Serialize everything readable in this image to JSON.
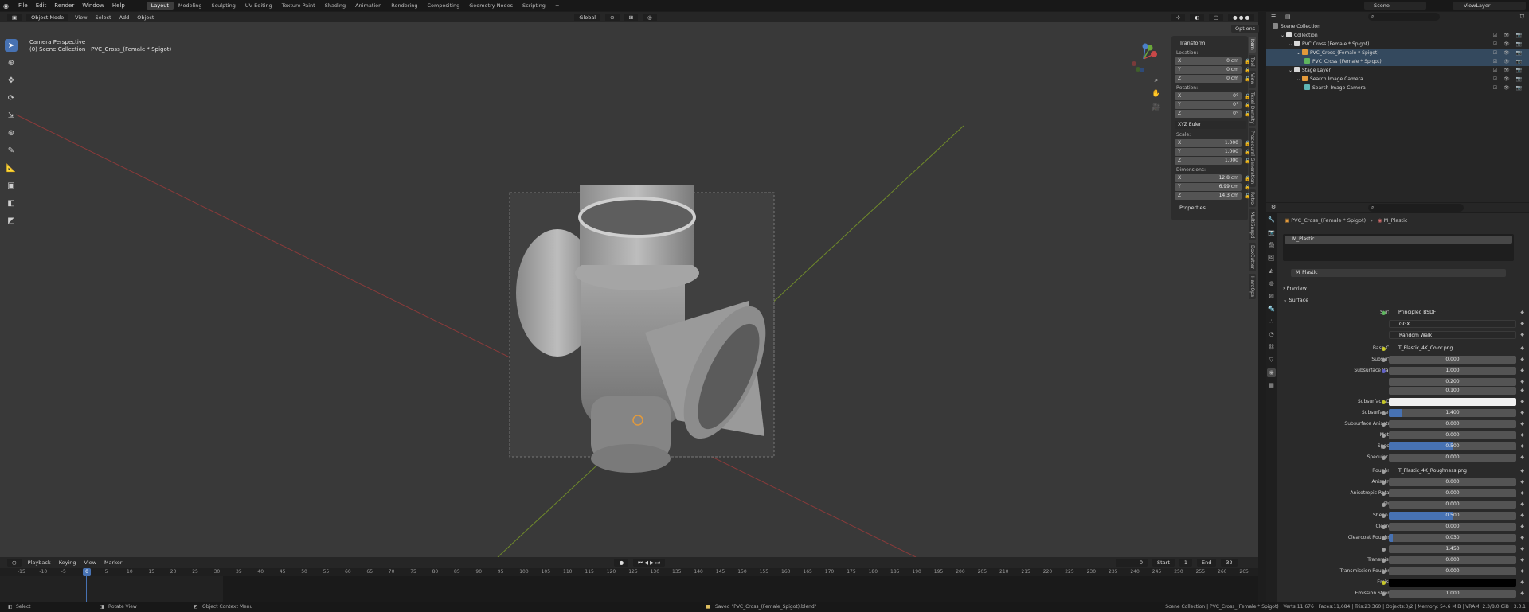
{
  "menu": [
    "File",
    "Edit",
    "Render",
    "Window",
    "Help"
  ],
  "workspaces": [
    "Layout",
    "Modeling",
    "Sculpting",
    "UV Editing",
    "Texture Paint",
    "Shading",
    "Animation",
    "Rendering",
    "Compositing",
    "Geometry Nodes",
    "Scripting"
  ],
  "scene_name": "Scene",
  "view_layer": "ViewLayer",
  "viewport": {
    "mode": "Object Mode",
    "menus": [
      "View",
      "Select",
      "Add",
      "Object"
    ],
    "orientation": "Global",
    "camera_label": "Camera Perspective",
    "collection_label": "(0) Scene Collection | PVC_Cross_(Female * Spigot)",
    "options": "Options",
    "side_tabs": [
      "Item",
      "Tool",
      "View",
      "Texel Density",
      "Procedural Generation",
      "Retro",
      "MultiSnapd",
      "BoxCutter",
      "HardOps"
    ]
  },
  "transform": {
    "title": "Transform",
    "location_label": "Location:",
    "location": [
      [
        "X",
        "0 cm"
      ],
      [
        "Y",
        "0 cm"
      ],
      [
        "Z",
        "0 cm"
      ]
    ],
    "rotation_label": "Rotation:",
    "rotation": [
      [
        "X",
        "0°"
      ],
      [
        "Y",
        "0°"
      ],
      [
        "Z",
        "0°"
      ]
    ],
    "rotation_mode": "XYZ Euler",
    "scale_label": "Scale:",
    "scale": [
      [
        "X",
        "1.000"
      ],
      [
        "Y",
        "1.000"
      ],
      [
        "Z",
        "1.000"
      ]
    ],
    "dimensions_label": "Dimensions:",
    "dimensions": [
      [
        "X",
        "12.8 cm"
      ],
      [
        "Y",
        "6.99 cm"
      ],
      [
        "Z",
        "14.3 cm"
      ]
    ],
    "properties": "Properties"
  },
  "timeline": {
    "menus": [
      "Playback",
      "Keying",
      "View",
      "Marker"
    ],
    "current_frame": "0",
    "start_label": "Start",
    "start": "1",
    "end_label": "End",
    "end": "32",
    "ticks": [
      "-15",
      "-10",
      "-5",
      "0",
      "5",
      "10",
      "15",
      "20",
      "25",
      "30",
      "35",
      "40",
      "45",
      "50",
      "55",
      "60",
      "65",
      "70",
      "75",
      "80",
      "85",
      "90",
      "95",
      "100",
      "105",
      "110",
      "115",
      "120",
      "125",
      "130",
      "135",
      "140",
      "145",
      "150",
      "155",
      "160",
      "165",
      "170",
      "175",
      "180",
      "185",
      "190",
      "195",
      "200",
      "205",
      "210",
      "215",
      "220",
      "225",
      "230",
      "235",
      "240",
      "245",
      "250",
      "255",
      "260",
      "265"
    ]
  },
  "status": {
    "select": "Select",
    "rotate": "Rotate View",
    "context": "Object Context Menu",
    "saved": "Saved \"PVC_Cross_(Female_Spigot).blend\"",
    "stats": "Scene Collection | PVC_Cross_(Female * Spigot) | Verts:11,676 | Faces:11,684 | Tris:23,360 | Objects:0/2 | Memory: 54.6 MiB | VRAM: 2.3/8.0 GiB | 3.3.1"
  },
  "outliner": [
    {
      "label": "Scene Collection",
      "indent": 0,
      "color": "#888888"
    },
    {
      "label": "Collection",
      "indent": 1,
      "color": "#d8d8d8"
    },
    {
      "label": "PVC Cross (Female * Spigot)",
      "indent": 2,
      "color": "#d8d8d8"
    },
    {
      "label": "PVC_Cross_(Female * Spigot)",
      "indent": 3,
      "color": "#e39a3b"
    },
    {
      "label": "PVC_Cross_(Female * Spigot)",
      "indent": 4,
      "color": "#5fb65f"
    },
    {
      "label": "Stage Layer",
      "indent": 2,
      "color": "#d8d8d8"
    },
    {
      "label": "Search Image Camera",
      "indent": 3,
      "color": "#e39a3b"
    },
    {
      "label": "Search Image Camera",
      "indent": 4,
      "color": "#5fb6b6"
    }
  ],
  "properties": {
    "breadcrumb_object": "PVC_Cross_(Female * Spigot)",
    "breadcrumb_material": "M_Plastic",
    "slot": "M_Plastic",
    "material": "M_Plastic",
    "preview": "Preview",
    "surface": "Surface",
    "rows": [
      {
        "label": "Surface",
        "type": "tex",
        "value": "Principled BSDF",
        "dot": "#5fb65f"
      },
      {
        "label": "",
        "type": "sel",
        "value": "GGX"
      },
      {
        "label": "",
        "type": "sel",
        "value": "Random Walk"
      },
      {
        "label": "Base Color",
        "type": "tex",
        "value": "T_Plastic_4K_Color.png",
        "dot": "#c7c729"
      },
      {
        "label": "Subsurface",
        "type": "num",
        "value": "0.000",
        "fill": 0,
        "dot": "#a1a1a1"
      },
      {
        "label": "Subsurface Radius",
        "type": "num",
        "value": "1.000",
        "fill": 0,
        "dot": "#6363c7"
      },
      {
        "label": "",
        "type": "num",
        "value": "0.200",
        "fill": 0
      },
      {
        "label": "",
        "type": "num",
        "value": "0.100",
        "fill": 0
      },
      {
        "label": "Subsurface Color",
        "type": "color",
        "value": "",
        "fill": 0,
        "dot": "#c7c729"
      },
      {
        "label": "Subsurface IOR",
        "type": "num",
        "value": "1.400",
        "fill": 0.1,
        "dot": "#a1a1a1"
      },
      {
        "label": "Subsurface Anisotropy",
        "type": "num",
        "value": "0.000",
        "fill": 0,
        "dot": "#a1a1a1"
      },
      {
        "label": "Metallic",
        "type": "num",
        "value": "0.000",
        "fill": 0,
        "dot": "#a1a1a1"
      },
      {
        "label": "Specular",
        "type": "num",
        "value": "0.500",
        "fill": 0.5,
        "dot": "#a1a1a1"
      },
      {
        "label": "Specular Tint",
        "type": "num",
        "value": "0.000",
        "fill": 0,
        "dot": "#a1a1a1"
      },
      {
        "label": "Roughness",
        "type": "tex",
        "value": "T_Plastic_4K_Roughness.png",
        "dot": "#a1a1a1"
      },
      {
        "label": "Anisotropic",
        "type": "num",
        "value": "0.000",
        "fill": 0,
        "dot": "#a1a1a1"
      },
      {
        "label": "Anisotropic Rotation",
        "type": "num",
        "value": "0.000",
        "fill": 0,
        "dot": "#a1a1a1"
      },
      {
        "label": "Sheen",
        "type": "num",
        "value": "0.000",
        "fill": 0,
        "dot": "#a1a1a1"
      },
      {
        "label": "Sheen Tint",
        "type": "num",
        "value": "0.500",
        "fill": 0.5,
        "dot": "#a1a1a1"
      },
      {
        "label": "Clearcoat",
        "type": "num",
        "value": "0.000",
        "fill": 0,
        "dot": "#a1a1a1"
      },
      {
        "label": "Clearcoat Roughness",
        "type": "num",
        "value": "0.030",
        "fill": 0.03,
        "dot": "#a1a1a1"
      },
      {
        "label": "IOR",
        "type": "num",
        "value": "1.450",
        "fill": 0,
        "dot": "#a1a1a1"
      },
      {
        "label": "Transmission",
        "type": "num",
        "value": "0.000",
        "fill": 0,
        "dot": "#a1a1a1"
      },
      {
        "label": "Transmission Roughness",
        "type": "num",
        "value": "0.000",
        "fill": 0,
        "dot": "#a1a1a1"
      },
      {
        "label": "Emission",
        "type": "black",
        "value": "",
        "fill": 0,
        "dot": "#c7c729"
      },
      {
        "label": "Emission Strength",
        "type": "num",
        "value": "1.000",
        "fill": 0,
        "dot": "#a1a1a1"
      }
    ]
  }
}
